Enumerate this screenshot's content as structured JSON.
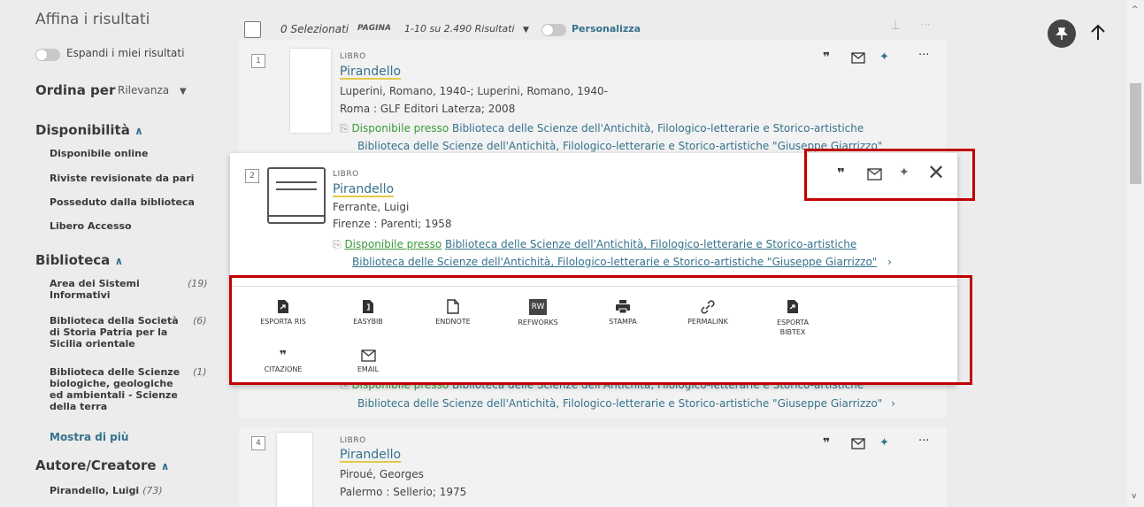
{
  "sidebar": {
    "title": "Affina i risultati",
    "expand_label": "Espandi i miei risultati",
    "sort_label": "Ordina per",
    "sort_value": "Rilevanza",
    "availability": {
      "heading": "Disponibilità",
      "items": [
        "Disponibile online",
        "Riviste revisionate da pari",
        "Posseduto dalla biblioteca",
        "Libero Accesso"
      ]
    },
    "library": {
      "heading": "Biblioteca",
      "items": [
        {
          "label": "Area dei Sistemi Informativi",
          "count": "(19)"
        },
        {
          "label": "Biblioteca della Società di Storia Patria per la Sicilia orientale",
          "count": "(6)"
        },
        {
          "label": "Biblioteca delle Scienze biologiche, geologiche ed ambientali - Scienze della terra",
          "count": "(1)"
        }
      ],
      "more": "Mostra di più"
    },
    "author": {
      "heading": "Autore/Creatore",
      "items": [
        {
          "label": "Pirandello, Luigi",
          "count": "(73)"
        }
      ]
    }
  },
  "topbar": {
    "selected": "0 Selezionati",
    "page_label": "PAGINA",
    "range": "1-10 su 2.490 Risultati",
    "personalize": "Personalizza"
  },
  "results": [
    {
      "num": "1",
      "type": "LIBRO",
      "title": "Pirandello",
      "authors": "Luperini, Romano, 1940-; Luperini, Romano, 1940-",
      "publisher": "Roma : GLF Editori Laterza; 2008",
      "avail_prefix": "Disponibile presso",
      "avail_lib": "Biblioteca delle Scienze dell'Antichità, Filologico-letterarie e Storico-artistiche",
      "avail_lib2": "Biblioteca delle Scienze dell'Antichità, Filologico-letterarie e Storico-artistiche \"Giuseppe Giarrizzo\""
    },
    {
      "num": "2",
      "type": "LIBRO",
      "title": "Pirandello",
      "authors": "Ferrante, Luigi",
      "publisher": "Firenze : Parenti; 1958",
      "avail_prefix": "Disponibile presso",
      "avail_lib": "Biblioteca delle Scienze dell'Antichità, Filologico-letterarie e Storico-artistiche",
      "avail_lib2": "Biblioteca delle Scienze dell'Antichità, Filologico-letterarie e Storico-artistiche \"Giuseppe Giarrizzo\""
    },
    {
      "avail_prefix": "Disponibile presso",
      "avail_lib": "Biblioteca delle Scienze dell'Antichità, Filologico-letterarie e Storico-artistiche",
      "avail_lib2": "Biblioteca delle Scienze dell'Antichità, Filologico-letterarie e Storico-artistiche \"Giuseppe Giarrizzo\""
    },
    {
      "num": "4",
      "type": "LIBRO",
      "title": "Pirandello",
      "authors": "Piroué, Georges",
      "publisher": "Palermo : Sellerio; 1975"
    }
  ],
  "actions": [
    "ESPORTA RIS",
    "EASYBIB",
    "ENDNOTE",
    "REFWORKS",
    "STAMPA",
    "PERMALINK",
    "ESPORTA BIBTEX",
    "CITAZIONE",
    "EMAIL"
  ],
  "refworks_badge": "RW",
  "colors": {
    "link": "#35718c",
    "available": "#3a9a3a",
    "highlight_box": "#c00000",
    "title_underline": "#e3c94a"
  }
}
